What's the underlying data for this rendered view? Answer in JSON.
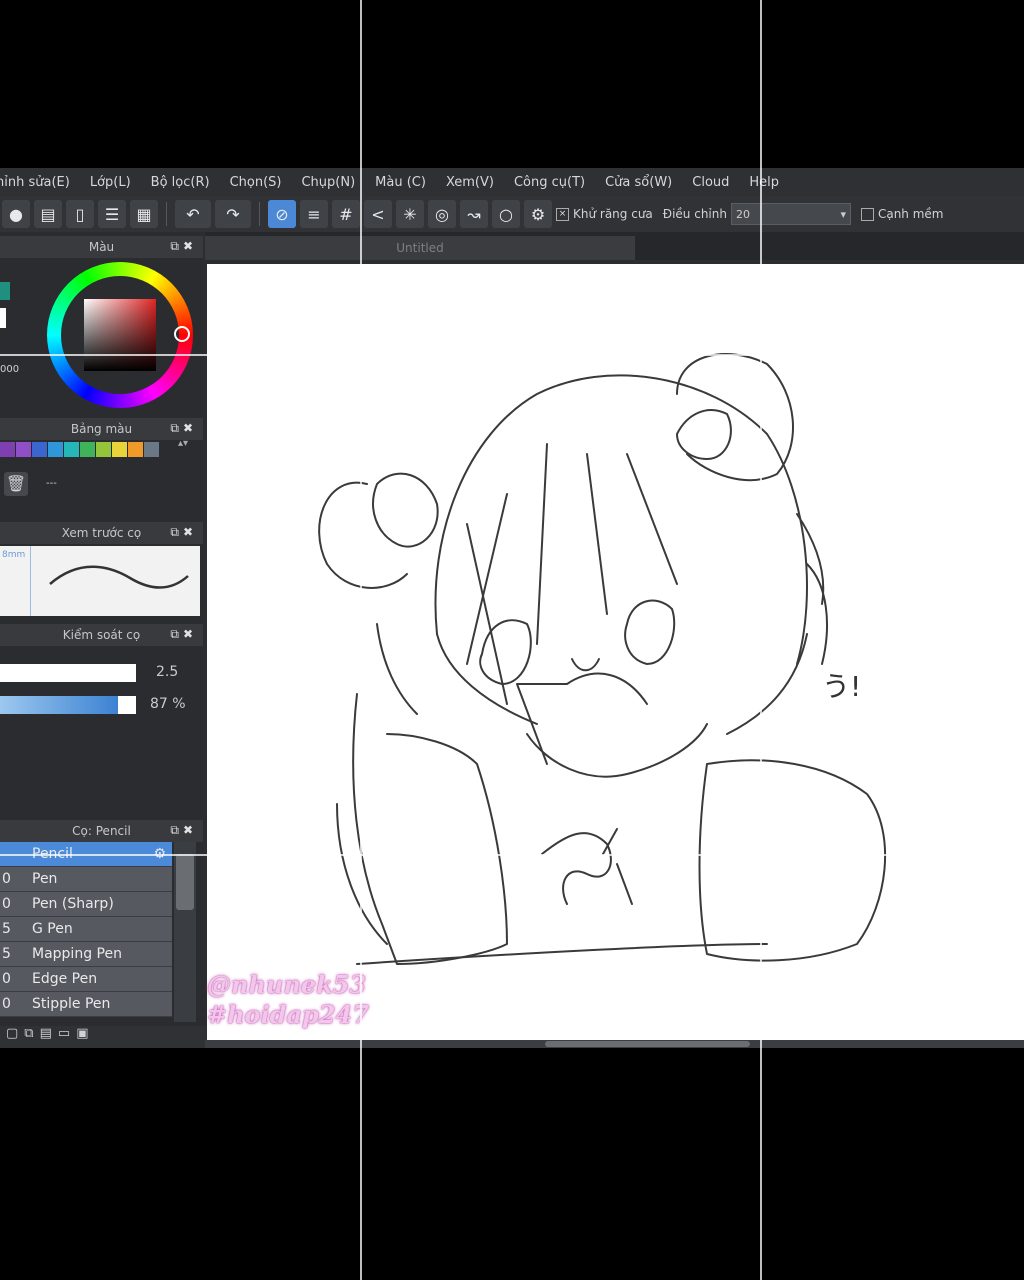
{
  "menu": [
    "hỉnh sửa(E)",
    "Lớp(L)",
    "Bộ lọc(R)",
    "Chọn(S)",
    "Chụp(N)",
    "Màu (C)",
    "Xem(V)",
    "Công cụ(T)",
    "Cửa sổ(W)",
    "Cloud",
    "Help"
  ],
  "toolbar": {
    "antialias_label": "Khử răng cưa",
    "adjust_label": "Điều chỉnh",
    "adjust_value": "20",
    "soft_edge_label": "Cạnh mềm"
  },
  "panels": {
    "color": {
      "title": "Màu",
      "hex": "000"
    },
    "palette": {
      "title": "Bảng màu",
      "colors": [
        "#7e3fb0",
        "#8f4fc6",
        "#3a66d0",
        "#2f97d9",
        "#25b7b8",
        "#3fb35a",
        "#93c43a",
        "#e9d33a",
        "#f09a2a",
        "#6b7886"
      ],
      "extra": "---"
    },
    "preview": {
      "title": "Xem trước cọ",
      "size_tag": "8mm"
    },
    "brush_control": {
      "title": "Kiểm soát cọ",
      "size_value": "2.5",
      "opacity_value": "87 %",
      "opacity_fraction": 0.87
    },
    "brushes": {
      "title": "Cọ: Pencil",
      "items": [
        {
          "size": "",
          "name": "Pencil",
          "selected": true
        },
        {
          "size": "0",
          "name": "Pen"
        },
        {
          "size": "0",
          "name": "Pen (Sharp)"
        },
        {
          "size": "5",
          "name": "G Pen"
        },
        {
          "size": "5",
          "name": "Mapping Pen"
        },
        {
          "size": "0",
          "name": "Edge Pen"
        },
        {
          "size": "0",
          "name": "Stipple Pen"
        }
      ]
    }
  },
  "document": {
    "tab_title": "Untitled",
    "sketch_text": "う!"
  },
  "watermark": {
    "line1": "@nhunek53",
    "line2": "#hoidap247"
  },
  "colors": {
    "accent": "#4b89d6",
    "panel": "#2a2c2f"
  }
}
